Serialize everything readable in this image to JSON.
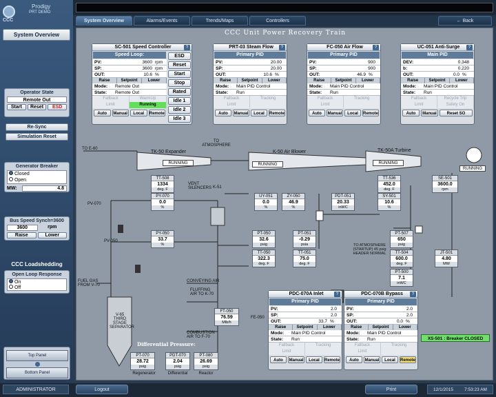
{
  "app": {
    "title_line1": "Prodigy",
    "title_line2": "PRT DEMO",
    "logo_text": "CCC"
  },
  "sidebar": {
    "system_overview": "System Overview",
    "operator_state": {
      "title": "Operator State",
      "mode": "Remote Out",
      "start": "Start",
      "reset": "Reset",
      "esd": "ESD"
    },
    "resync": "Re-Sync",
    "simulation_reset": "Simulation Reset",
    "generator_breaker": {
      "title": "Generator Breaker",
      "closed": "Closed",
      "open": "Open",
      "mw_label": "MW:",
      "mw_value": "4.8"
    },
    "bus_speed": {
      "title": "Bus Speed Synch=3600",
      "value": "3600",
      "unit": "rpm",
      "raise": "Raise",
      "lower": "Lower"
    },
    "loadshedding": {
      "title": "CCC Loadshedding",
      "open_loop": "Open Loop Response",
      "on": "On",
      "off": "Off"
    },
    "top_panel": "Top Panel",
    "bottom_panel": "Bottom Panel"
  },
  "tabs": [
    "System Overview",
    "Alarms/Events",
    "Trends/Maps",
    "Controllers"
  ],
  "back": "Back",
  "main_title": "CCC Unit Power Recovery Train",
  "sc501": {
    "title": "SC-501 Speed Controller",
    "sub": "Speed Loop:",
    "pv": "3600",
    "sp": "3600",
    "out": "10.6",
    "unit_pv": "rpm",
    "unit_out": "%",
    "raise": "Raise",
    "setpoint": "Setpoint",
    "lower": "Lower",
    "mode": "Remote Out",
    "state": "Remote Out",
    "fallback": "Fallback",
    "warmup": "WarmUp",
    "limit": "Limit",
    "running": "Running",
    "auto": "Auto",
    "manual": "Manual",
    "local": "Local",
    "remote": "Remote",
    "side_buttons": [
      "ESD",
      "Reset",
      "Start",
      "Stop",
      "Rated",
      "Idle 1",
      "Idle 2",
      "Idle 3"
    ]
  },
  "prt03": {
    "title": "PRT-03 Steam Flow",
    "sub": "Primary PID",
    "pv": "20.00",
    "sp": "20.00",
    "out": "10.6",
    "mode": "Main PID Control",
    "state": "Run",
    "tracking": "Tracking"
  },
  "fc050": {
    "title": "FC-050 Air Flow",
    "sub": "Primary PID",
    "pv": "900",
    "sp": "900",
    "out": "46.9",
    "mode": "Main PID Control",
    "state": "Run"
  },
  "uc051": {
    "title": "UC-051 Anti-Surge",
    "sub": "Main PID",
    "dev": "0.348",
    "b": "0.220",
    "out": "0.0",
    "mode": "Main PID Control",
    "state": "Run",
    "recycle_trip": "Recycle Trip",
    "safety_on": "Safety On",
    "reset_so": "Reset SO"
  },
  "pdc070a": {
    "title": "PDC-070A Inlet",
    "sub": "Primary PID",
    "pv": "2.0",
    "sp": "2.0",
    "out": "33.7",
    "mode": "Main PID Control",
    "state": "Run"
  },
  "pdc070b": {
    "title": "PDC-070B Bypass",
    "sub": "Primary PID",
    "pv": "2.0",
    "sp": "2.0",
    "out": "0.0",
    "mode": "Main PID Control",
    "state": "Run"
  },
  "labels": {
    "pv": "PV:",
    "sp": "SP:",
    "out": "OUT:",
    "mode": "Mode:",
    "state": "State:",
    "dev": "DEV:",
    "b": "b:",
    "pct": "%",
    "limit": "Limit",
    "fallback": "Fallback",
    "tracking": "Tracking"
  },
  "diagram": {
    "to_e60": "TO E-60",
    "tk50": "TK-50 Expander",
    "to_atm": "TO ATMOSPHERE",
    "k50": "K-50 Air Blower",
    "tk50a": "TK-50A Turbine",
    "running": "RUNNING",
    "vent": "VENT SILENCERS",
    "k51": "K-51",
    "pv070": "PV-070",
    "pv050": "PV-050",
    "fuel_gas": "FUEL GAS FROM V-70",
    "v65": "V-65 THIRD STAGE SEPARATOR",
    "conveying": "CONVEYING AIR",
    "fluffing": "FLUFFING AIR TO K-70",
    "combustion": "COMBUSTION AIR TO F-70",
    "fe050": "FE-050",
    "to_atm2": "TO ATMOSPHERE (STARTUP) 45 psig HEADER NORMAL",
    "diff": "Differential Pressure:",
    "breaker": "XS-501 : Breaker CLOSED"
  },
  "tags": [
    {
      "n": "TT-508",
      "v": "1334",
      "u": "deg. F"
    },
    {
      "n": "PY-070",
      "v": "0.0",
      "u": "%"
    },
    {
      "n": "PY-050",
      "v": "33.7",
      "u": "%"
    },
    {
      "n": "UY-051",
      "v": "0.0",
      "u": "%"
    },
    {
      "n": "ZY-050",
      "v": "46.9",
      "u": "%"
    },
    {
      "n": "PDT-051",
      "v": "20.33",
      "u": "inWC"
    },
    {
      "n": "TT-536",
      "v": "452.0",
      "u": "deg. F"
    },
    {
      "n": "SY-501",
      "v": "10.6",
      "u": "%"
    },
    {
      "n": "SE-501",
      "v": "3600.0",
      "u": "rpm"
    },
    {
      "n": "PT-050",
      "v": "32.6",
      "u": "psig"
    },
    {
      "n": "PT-051",
      "v": "-0.29",
      "u": "psia"
    },
    {
      "n": "TT-050",
      "v": "322.3",
      "u": "deg. F"
    },
    {
      "n": "TT-051",
      "v": "75.0",
      "u": "deg. F"
    },
    {
      "n": "PT-507",
      "v": "650",
      "u": "psig"
    },
    {
      "n": "TT-504",
      "v": "600.0",
      "u": "deg. F"
    },
    {
      "n": "JT-501",
      "v": "4.80",
      "u": "MW"
    },
    {
      "n": "PT-500",
      "v": "7.1",
      "u": "inWC"
    },
    {
      "n": "FT-050",
      "v": "76.59",
      "u": "Mlb/h"
    },
    {
      "n": "PT-070",
      "v": "28.72",
      "u": "psig"
    },
    {
      "n": "PDT-070",
      "v": "2.04",
      "u": "psig"
    },
    {
      "n": "PT-080",
      "v": "26.69",
      "u": "psig"
    }
  ],
  "diff_labels": [
    "Regenerator",
    "Differential",
    "Reactor"
  ],
  "footer": {
    "user": "ADMINISTRATOR",
    "logout": "Logout",
    "print": "Print",
    "date": "12/1/2015",
    "time": "7:53:23 AM"
  },
  "colors": {
    "accent": "#3f6591",
    "running": "#63e05a",
    "esd": "#c81e1e",
    "breaker": "#6fe06a"
  }
}
